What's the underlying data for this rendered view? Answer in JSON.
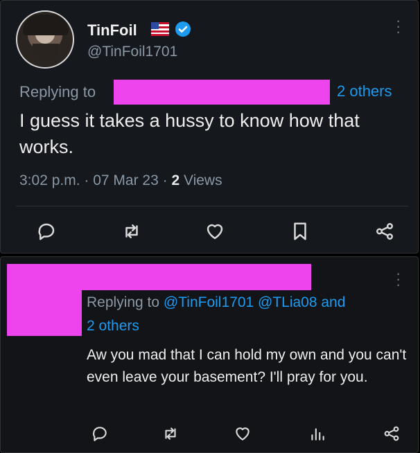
{
  "tweet1": {
    "display_name": "TinFoil",
    "flag_icon": "us-flag-icon",
    "verified_icon": "verified-badge-icon",
    "handle": "@TinFoil1701",
    "replying_prefix": "Replying to",
    "replying_suffix": "2 others",
    "text": "I guess it takes a hussy to know how that works.",
    "time": "3:02 p.m. · 07 Mar 23 · ",
    "views_count": "2",
    "views_label": " Views",
    "actions": [
      "reply-icon",
      "retweet-icon",
      "like-icon",
      "bookmark-icon",
      "share-icon"
    ]
  },
  "tweet2": {
    "replying_prefix": "Replying to ",
    "mention1": "@TinFoil1701",
    "mention2": " @TLia08 and",
    "others": "2 others",
    "text": "Aw you mad that I can hold my own and you can't even leave your basement? I'll pray for you.",
    "actions": [
      "reply-icon",
      "retweet-icon",
      "like-icon",
      "analytics-icon",
      "share-icon"
    ]
  },
  "colors": {
    "background": "#000000",
    "card": "#15181c",
    "accent": "#1d9bf0",
    "muted": "#8b98a5",
    "redaction": "#ee44ee"
  }
}
